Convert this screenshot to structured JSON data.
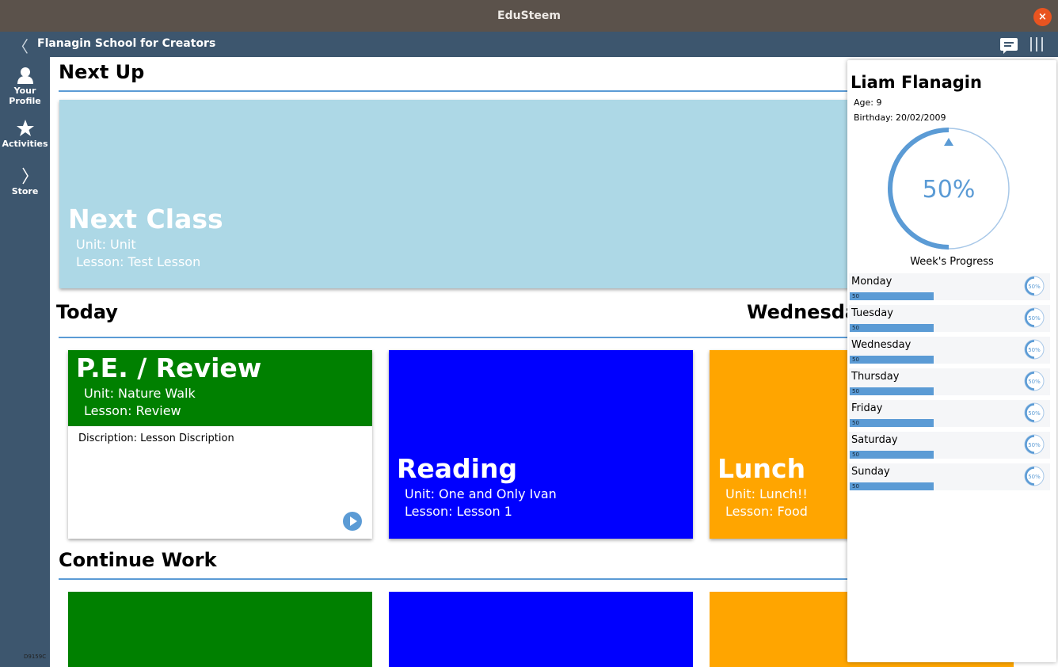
{
  "window": {
    "title": "EduSteem",
    "close_glyph": "×"
  },
  "appbar": {
    "back_glyph": "〈",
    "school_name": "Flanagin School for Creators",
    "chat_icon": "chat-icon",
    "menu_icon": "columns-menu-icon"
  },
  "sidebar": {
    "items": [
      {
        "label_line1": "Your",
        "label_line2": "Profile",
        "icon": "person-icon"
      },
      {
        "label": "Activities",
        "icon": "star-icon"
      },
      {
        "label": "Store",
        "icon": "chevron-right-icon"
      }
    ],
    "footer_text": "D9159C"
  },
  "next_up": {
    "heading": "Next Up",
    "card": {
      "title": "Next Class",
      "unit": "Unit: Unit",
      "lesson": "Lesson: Test Lesson",
      "color": "#add8e6"
    }
  },
  "today": {
    "heading": "Today",
    "day_heading": "Wednesda",
    "cards": [
      {
        "title": "P.E. / Review",
        "unit": "Unit: Nature Walk",
        "lesson": "Lesson: Review",
        "description": "Discription: Lesson Discription",
        "color": "#008000"
      },
      {
        "title": "Reading",
        "unit": "Unit: One and Only Ivan",
        "lesson": "Lesson: Lesson 1",
        "color": "#0000ff"
      },
      {
        "title": "Lunch",
        "unit": "Unit: Lunch!!",
        "lesson": "Lesson: Food",
        "color": "#ffa500"
      }
    ]
  },
  "continue_work": {
    "heading": "Continue Work",
    "card_colors": [
      "#008000",
      "#0000ff",
      "#ffa500"
    ]
  },
  "profile": {
    "name": "Liam Flanagin",
    "age": "Age: 9",
    "birthday": "Birthday: 20/02/2009",
    "week_progress_text": "50%",
    "week_progress_value": 0.5,
    "week_progress_label": "Week's Progress",
    "days": [
      {
        "name": "Monday",
        "value": "50",
        "pct_text": "50%"
      },
      {
        "name": "Tuesday",
        "value": "50",
        "pct_text": "50%"
      },
      {
        "name": "Wednesday",
        "value": "50",
        "pct_text": "50%"
      },
      {
        "name": "Thursday",
        "value": "50",
        "pct_text": "50%"
      },
      {
        "name": "Friday",
        "value": "50",
        "pct_text": "50%"
      },
      {
        "name": "Saturday",
        "value": "50",
        "pct_text": "50%"
      },
      {
        "name": "Sunday",
        "value": "50",
        "pct_text": "50%"
      }
    ],
    "accent_color": "#5b9bd5"
  }
}
